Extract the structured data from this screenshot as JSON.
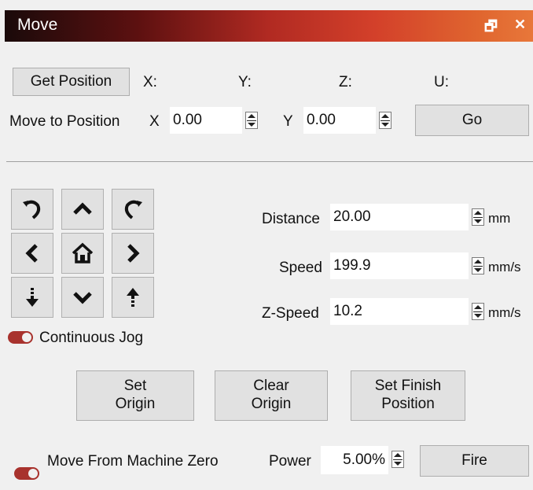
{
  "window": {
    "title": "Move",
    "restore_glyph": "🗗",
    "close_glyph": "✕"
  },
  "position": {
    "get_position_label": "Get Position",
    "x_label": "X:",
    "y_label": "Y:",
    "z_label": "Z:",
    "u_label": "U:"
  },
  "move_to": {
    "label": "Move to Position",
    "x_label": "X",
    "x_value": "0.00",
    "y_label": "Y",
    "y_value": "0.00",
    "go_label": "Go"
  },
  "jog": {
    "icons": [
      "rotate-ccw-icon",
      "arrow-up-icon",
      "rotate-cw-icon",
      "arrow-left-icon",
      "home-icon",
      "arrow-right-icon",
      "z-down-icon",
      "arrow-down-icon",
      "z-up-icon"
    ],
    "continuous_label": "Continuous Jog"
  },
  "params": {
    "distance_label": "Distance",
    "distance_value": "20.00",
    "distance_unit": "mm",
    "speed_label": "Speed",
    "speed_value": "199.9",
    "speed_unit": "mm/s",
    "zspeed_label": "Z-Speed",
    "zspeed_value": "10.2",
    "zspeed_unit": "mm/s"
  },
  "origin": {
    "set_origin_line1": "Set",
    "set_origin_line2": "Origin",
    "clear_origin_line1": "Clear",
    "clear_origin_line2": "Origin",
    "set_finish_line1": "Set Finish",
    "set_finish_line2": "Position"
  },
  "bottom": {
    "machine_zero_label": "Move From Machine Zero",
    "power_label": "Power",
    "power_value": "5.00%",
    "fire_label": "Fire"
  },
  "colors": {
    "toggle_on": "#a8322d",
    "button_bg": "#e1e1e1"
  }
}
